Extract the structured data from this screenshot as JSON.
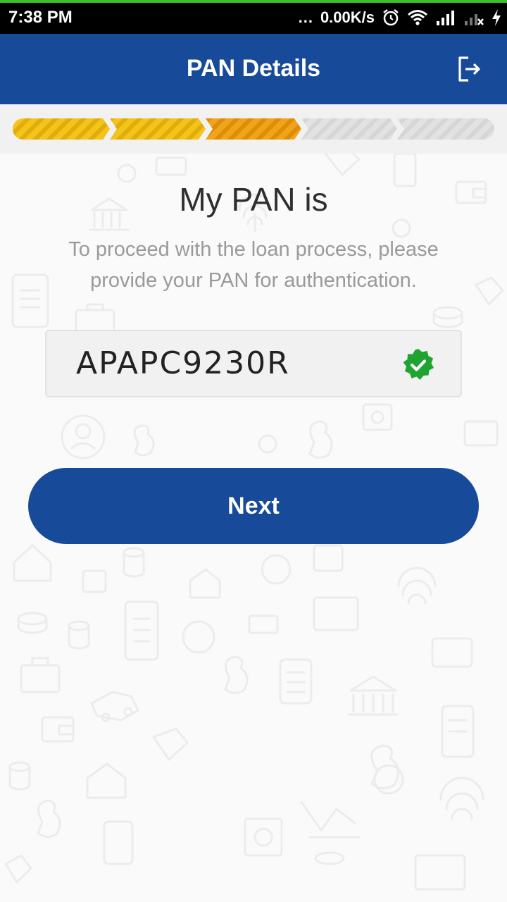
{
  "status_bar": {
    "time": "7:38 PM",
    "overflow": "...",
    "net_speed": "0.00K/s",
    "icons": [
      "alarm-icon",
      "wifi-icon",
      "signal-icon",
      "signal-no-sim-icon",
      "charging-icon"
    ]
  },
  "app_bar": {
    "title": "PAN Details",
    "logout_icon": "logout-icon"
  },
  "progress": {
    "total_steps": 5,
    "completed_steps": 3,
    "colors": {
      "done": "#f4c418",
      "current": "#f2a418",
      "pending": "#e2e2e2"
    }
  },
  "form": {
    "heading": "My PAN is",
    "subtext": "To proceed with the loan process, please provide your PAN for authentication.",
    "pan_value": "APAPC9230R",
    "verified_icon": "verified-check-icon"
  },
  "actions": {
    "next_label": "Next"
  },
  "colors": {
    "primary": "#174a98",
    "verified": "#1fa331",
    "status_accent": "#3fbf2f"
  }
}
